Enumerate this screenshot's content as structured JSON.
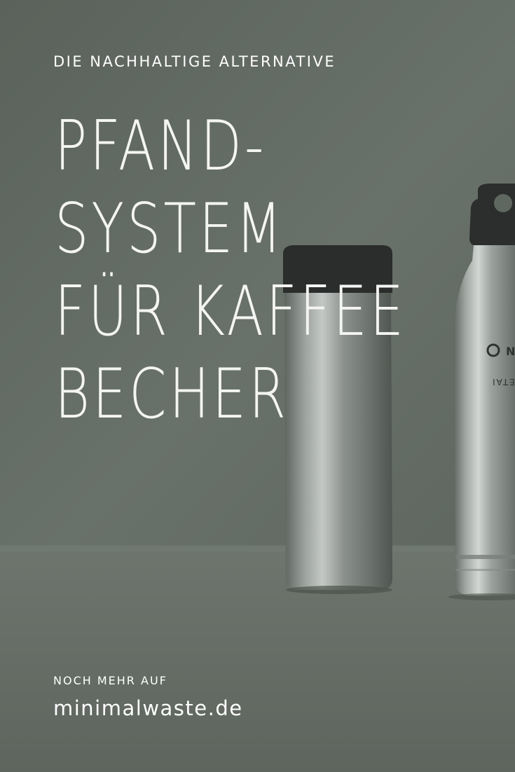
{
  "kicker": "DIE NACHHALTIGE ALTERNATIVE",
  "headline": {
    "line1": "PFAND-",
    "line2": "SYSTEM",
    "line3": "FÜR KAFFEE",
    "line4": "BECHER"
  },
  "footer": {
    "prefix": "NOCH MEHR AUF",
    "url": "minimalwaste.de"
  },
  "bottle_label": {
    "line1": "NIC",
    "line2": "DETAI"
  },
  "colors": {
    "background": "#5f6860",
    "text": "#ffffff"
  }
}
